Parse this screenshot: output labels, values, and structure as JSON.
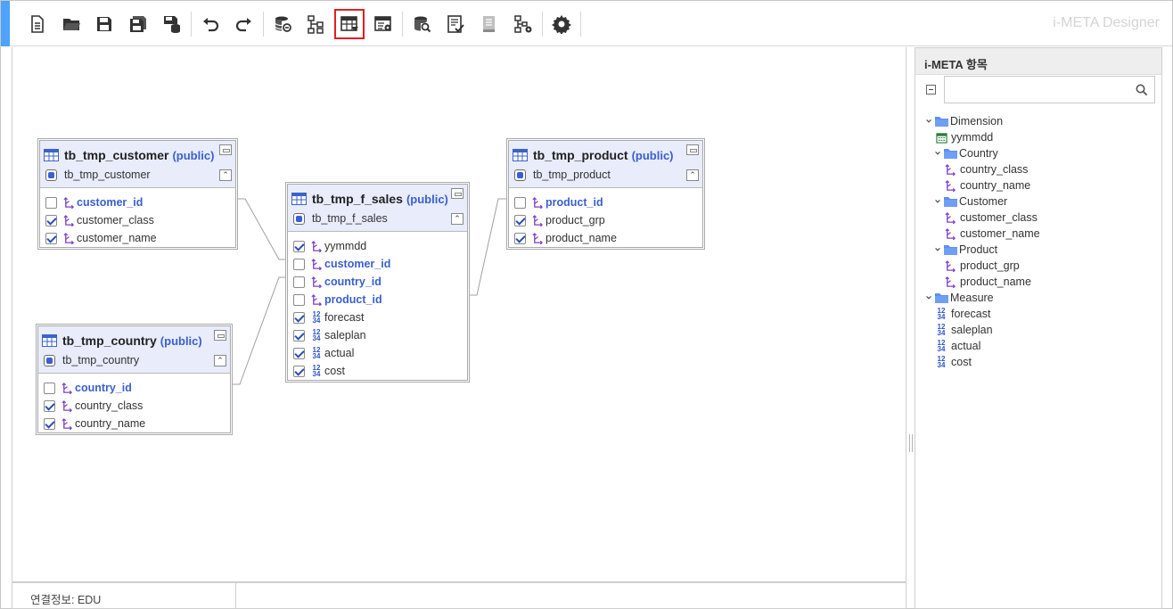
{
  "app": {
    "title": "i-META Designer",
    "accent_color": "#4da3ff"
  },
  "toolbar": {
    "buttons": [
      {
        "name": "new-document-icon"
      },
      {
        "name": "open-folder-icon"
      },
      {
        "name": "save-icon"
      },
      {
        "name": "save-all-icon"
      },
      {
        "name": "save-to-db-icon"
      },
      {
        "name": "undo-icon"
      },
      {
        "name": "redo-icon"
      },
      {
        "name": "datasource-link-icon"
      },
      {
        "name": "hierarchy-icon"
      },
      {
        "name": "table-filter-icon",
        "active": true
      },
      {
        "name": "table-settings-icon"
      },
      {
        "name": "db-search-icon"
      },
      {
        "name": "checklist-icon"
      },
      {
        "name": "document-icon"
      },
      {
        "name": "tree-settings-icon"
      },
      {
        "name": "gear-icon"
      }
    ]
  },
  "tables": {
    "customer": {
      "name": "tb_tmp_customer",
      "schema": "(public)",
      "alias": "tb_tmp_customer",
      "columns": [
        {
          "name": "customer_id",
          "checked": false,
          "key": true,
          "type": "dim"
        },
        {
          "name": "customer_class",
          "checked": true,
          "key": false,
          "type": "dim"
        },
        {
          "name": "customer_name",
          "checked": true,
          "key": false,
          "type": "dim"
        }
      ]
    },
    "country": {
      "name": "tb_tmp_country",
      "schema": "(public)",
      "alias": "tb_tmp_country",
      "columns": [
        {
          "name": "country_id",
          "checked": false,
          "key": true,
          "type": "dim"
        },
        {
          "name": "country_class",
          "checked": true,
          "key": false,
          "type": "dim"
        },
        {
          "name": "country_name",
          "checked": true,
          "key": false,
          "type": "dim"
        }
      ]
    },
    "f_sales": {
      "name": "tb_tmp_f_sales",
      "schema": "(public)",
      "alias": "tb_tmp_f_sales",
      "columns": [
        {
          "name": "yymmdd",
          "checked": true,
          "key": false,
          "type": "dim"
        },
        {
          "name": "customer_id",
          "checked": false,
          "key": true,
          "type": "dim"
        },
        {
          "name": "country_id",
          "checked": false,
          "key": true,
          "type": "dim"
        },
        {
          "name": "product_id",
          "checked": false,
          "key": true,
          "type": "dim"
        },
        {
          "name": "forecast",
          "checked": true,
          "key": false,
          "type": "num"
        },
        {
          "name": "saleplan",
          "checked": true,
          "key": false,
          "type": "num"
        },
        {
          "name": "actual",
          "checked": true,
          "key": false,
          "type": "num"
        },
        {
          "name": "cost",
          "checked": true,
          "key": false,
          "type": "num"
        }
      ]
    },
    "product": {
      "name": "tb_tmp_product",
      "schema": "(public)",
      "alias": "tb_tmp_product",
      "columns": [
        {
          "name": "product_id",
          "checked": false,
          "key": true,
          "type": "dim"
        },
        {
          "name": "product_grp",
          "checked": true,
          "key": false,
          "type": "dim"
        },
        {
          "name": "product_name",
          "checked": true,
          "key": false,
          "type": "dim"
        }
      ]
    }
  },
  "status_bar": {
    "connection": "연결정보: EDU"
  },
  "panel": {
    "title": "i-META 항목",
    "search_placeholder": "",
    "tree": [
      {
        "level": 0,
        "kind": "folder",
        "label": "Dimension"
      },
      {
        "level": 1,
        "kind": "date",
        "label": "yymmdd"
      },
      {
        "level": 1,
        "kind": "folder",
        "label": "Country"
      },
      {
        "level": 2,
        "kind": "dim",
        "label": "country_class"
      },
      {
        "level": 2,
        "kind": "dim",
        "label": "country_name"
      },
      {
        "level": 1,
        "kind": "folder",
        "label": "Customer"
      },
      {
        "level": 2,
        "kind": "dim",
        "label": "customer_class"
      },
      {
        "level": 2,
        "kind": "dim",
        "label": "customer_name"
      },
      {
        "level": 1,
        "kind": "folder",
        "label": "Product"
      },
      {
        "level": 2,
        "kind": "dim",
        "label": "product_grp"
      },
      {
        "level": 2,
        "kind": "dim",
        "label": "product_name"
      },
      {
        "level": 0,
        "kind": "folder",
        "label": "Measure"
      },
      {
        "level": 1,
        "kind": "num",
        "label": "forecast"
      },
      {
        "level": 1,
        "kind": "num",
        "label": "saleplan"
      },
      {
        "level": 1,
        "kind": "num",
        "label": "actual"
      },
      {
        "level": 1,
        "kind": "num",
        "label": "cost"
      }
    ]
  },
  "colors": {
    "key_column": "#3a5fd0",
    "table_header": "#e8ecfb",
    "dimension_icon": "#7b3fc9",
    "number_icon": "#2b56c6",
    "active_button_border": "#e02020"
  }
}
